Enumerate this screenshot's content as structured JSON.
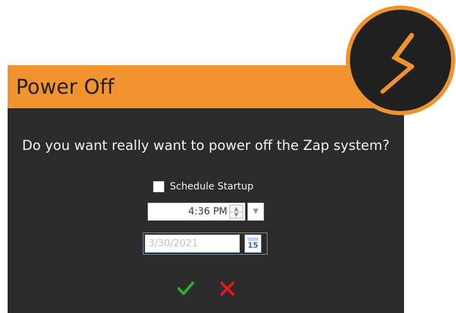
{
  "dialog": {
    "title": "Power Off",
    "question": "Do you want really want to power off the Zap system?"
  },
  "schedule": {
    "checkbox_label": "Schedule Startup",
    "time_value": "4:36 PM",
    "date_value": "3/30/2021",
    "calendar_day": "15"
  },
  "colors": {
    "titlebar": "#f0922e",
    "dialog_background": "#2b2b2b",
    "confirm": "#31a838",
    "cancel": "#e0191b"
  },
  "icons": {
    "logo": "lightning-bolt-logo",
    "confirm": "checkmark-icon",
    "cancel": "close-icon",
    "spinner_up": "chevron-up-icon",
    "spinner_down": "chevron-down-icon",
    "dropdown": "chevron-down-icon",
    "calendar": "calendar-icon"
  }
}
